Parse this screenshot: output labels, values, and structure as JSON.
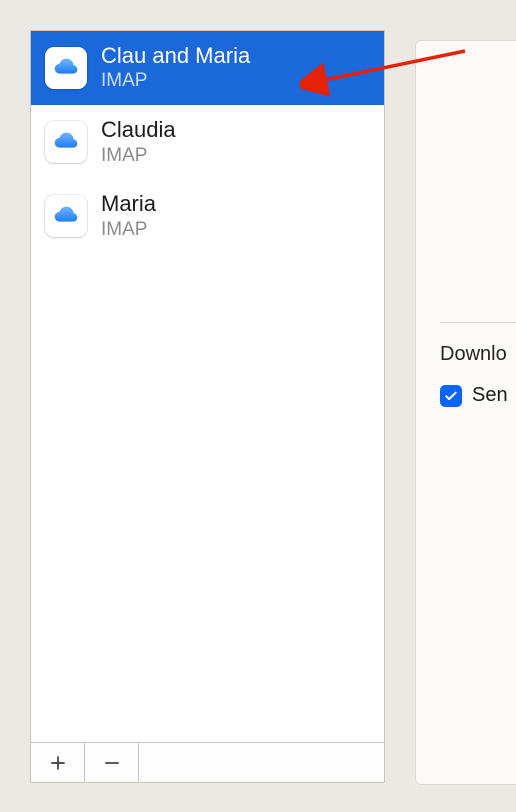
{
  "accounts": [
    {
      "name": "Clau and Maria",
      "type": "IMAP",
      "selected": true
    },
    {
      "name": "Claudia",
      "type": "IMAP",
      "selected": false
    },
    {
      "name": "Maria",
      "type": "IMAP",
      "selected": false
    }
  ],
  "right": {
    "download_label": "Downlo",
    "checkbox_checked": true,
    "checkbox_label": "Sen"
  },
  "icons": {
    "cloud": "cloud-icon",
    "plus": "plus-icon",
    "minus": "minus-icon",
    "check": "check-icon"
  }
}
